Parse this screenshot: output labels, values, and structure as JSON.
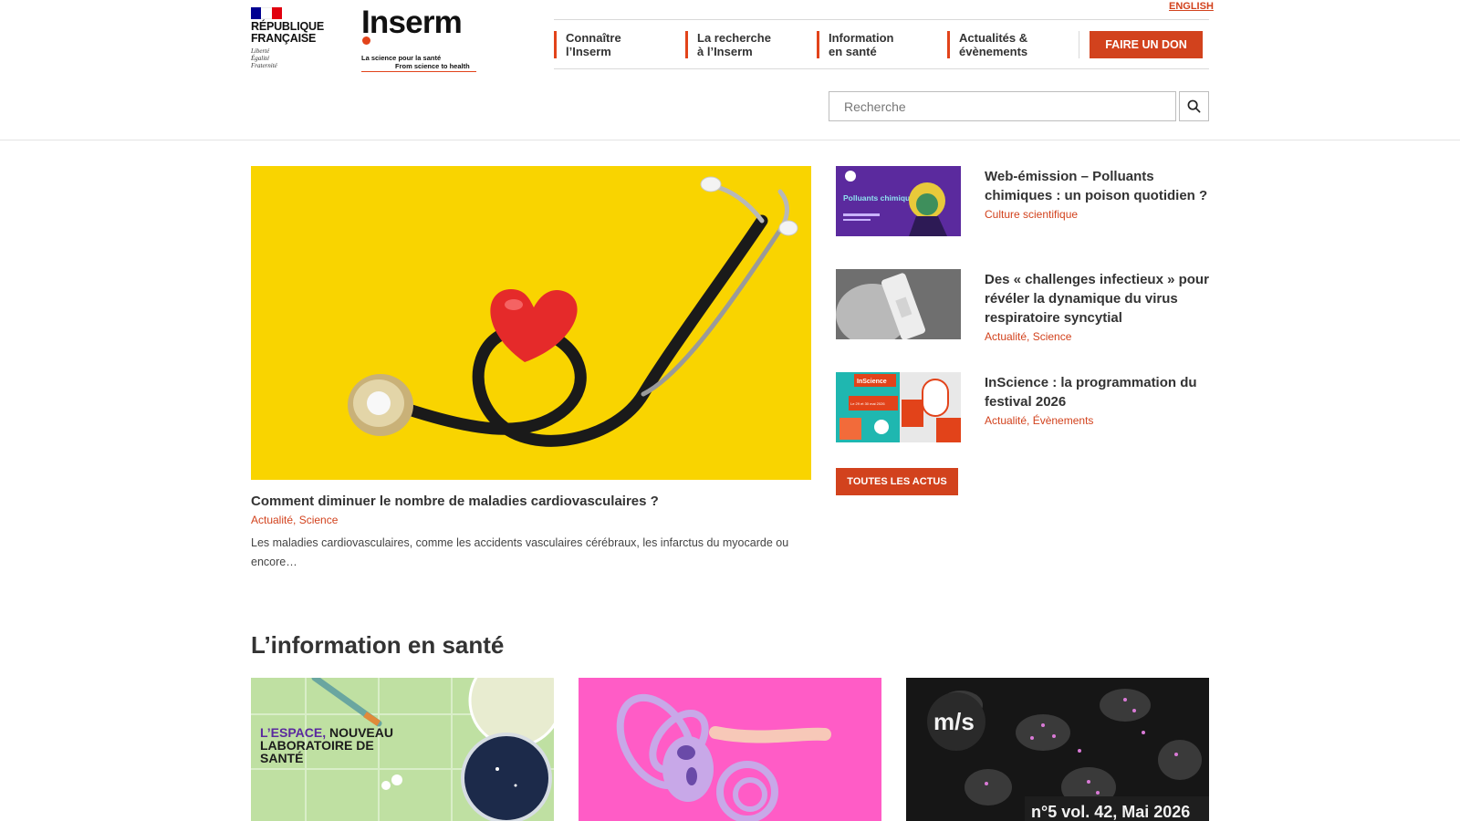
{
  "header": {
    "republique": {
      "title_line1": "RÉPUBLIQUE",
      "title_line2": "FRANÇAISE",
      "motto": [
        "Liberté",
        "Égalité",
        "Fraternité"
      ],
      "flag_colors": [
        "#000091",
        "#ffffff",
        "#e1000f"
      ]
    },
    "inserm": {
      "name": "Inserm",
      "tagline_fr": "La science pour la santé",
      "tagline_en": "From science to health"
    },
    "language_link": "ENGLISH",
    "nav": [
      {
        "line1": "Connaître",
        "line2": "l’Inserm"
      },
      {
        "line1": "La recherche",
        "line2": "à l’Inserm"
      },
      {
        "line1": "Information",
        "line2": "en santé"
      },
      {
        "line1": "Actualités &",
        "line2": "évènements"
      }
    ],
    "donate_label": "FAIRE UN DON",
    "search": {
      "placeholder": "Recherche",
      "icon": "search-icon"
    }
  },
  "feature": {
    "title": "Comment diminuer le nombre de maladies cardiovasculaires ?",
    "tags": "Actualité, Science",
    "description": "Les maladies cardiovasculaires, comme les accidents vasculaires cérébraux, les infarctus du myocarde ou encore…"
  },
  "news": [
    {
      "title": "Web-émission – Polluants chimiques : un poison quotidien ?",
      "tags": "Culture scientifique",
      "thumb_text": "Polluants chimiques"
    },
    {
      "title": "Des « challenges infectieux » pour révéler la dynamique du virus respiratoire syncytial",
      "tags": "Actualité, Science"
    },
    {
      "title": "InScience : la programmation du festival 2026",
      "tags": "Actualité, Évènements",
      "thumb_text": "InScience",
      "thumb_date": "Le 29 et 30 mai 2026"
    }
  ],
  "all_news_label": "TOUTES LES ACTUS",
  "info_sante": {
    "title": "L’information en santé",
    "cards": [
      {
        "overlay_line1_highlight": "L’ESPACE,",
        "overlay_line1_rest": " NOUVEAU",
        "overlay_line2": "LABORATOIRE DE",
        "overlay_line3": "SANTÉ"
      },
      {
        "overlay": ""
      },
      {
        "logo": "m/s",
        "caption": "n°5 vol. 42, Mai 2026"
      }
    ]
  },
  "colors": {
    "accent": "#d2421d",
    "text": "#333333"
  }
}
